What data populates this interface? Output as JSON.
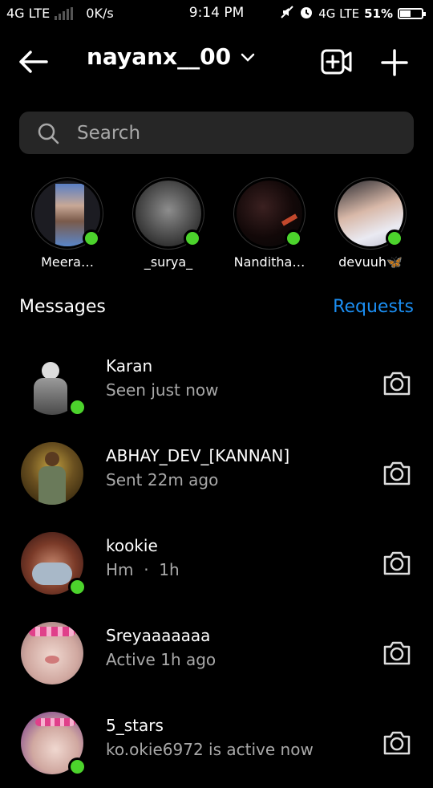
{
  "status_bar": {
    "network_left": "4G LTE",
    "speed": "0K/s",
    "time": "9:14 PM",
    "network_right": "4G LTE",
    "battery": "51%",
    "battery_level": 0.51
  },
  "header": {
    "username": "nayanx__00",
    "icons": [
      "back-arrow-icon",
      "chevron-down-icon",
      "video-chat-icon",
      "plus-icon"
    ]
  },
  "search": {
    "placeholder": "Search"
  },
  "stories": [
    {
      "name": "Meera…",
      "online": true
    },
    {
      "name": "_surya_",
      "online": true
    },
    {
      "name": "Nanditha…",
      "online": true
    },
    {
      "name": "devuuh🦋",
      "online": true
    }
  ],
  "messages_section": {
    "title": "Messages",
    "requests_label": "Requests"
  },
  "conversations": [
    {
      "name": "Karan",
      "status": "Seen just now",
      "online": true
    },
    {
      "name": "ABHAY_DEV_[KANNAN]",
      "status": "Sent 22m ago",
      "online": false
    },
    {
      "name": "kookie",
      "status": "Hm  ·  1h",
      "online": true
    },
    {
      "name": "Sreyaaaaaaa",
      "status": "Active 1h ago",
      "online": false
    },
    {
      "name": "5_stars",
      "status": "ko.okie6972 is active now",
      "online": true
    }
  ],
  "colors": {
    "background": "#000000",
    "search_bg": "#262626",
    "online_dot": "#4cd32c",
    "link": "#1b8ef2",
    "secondary_text": "#a8a8a8"
  }
}
